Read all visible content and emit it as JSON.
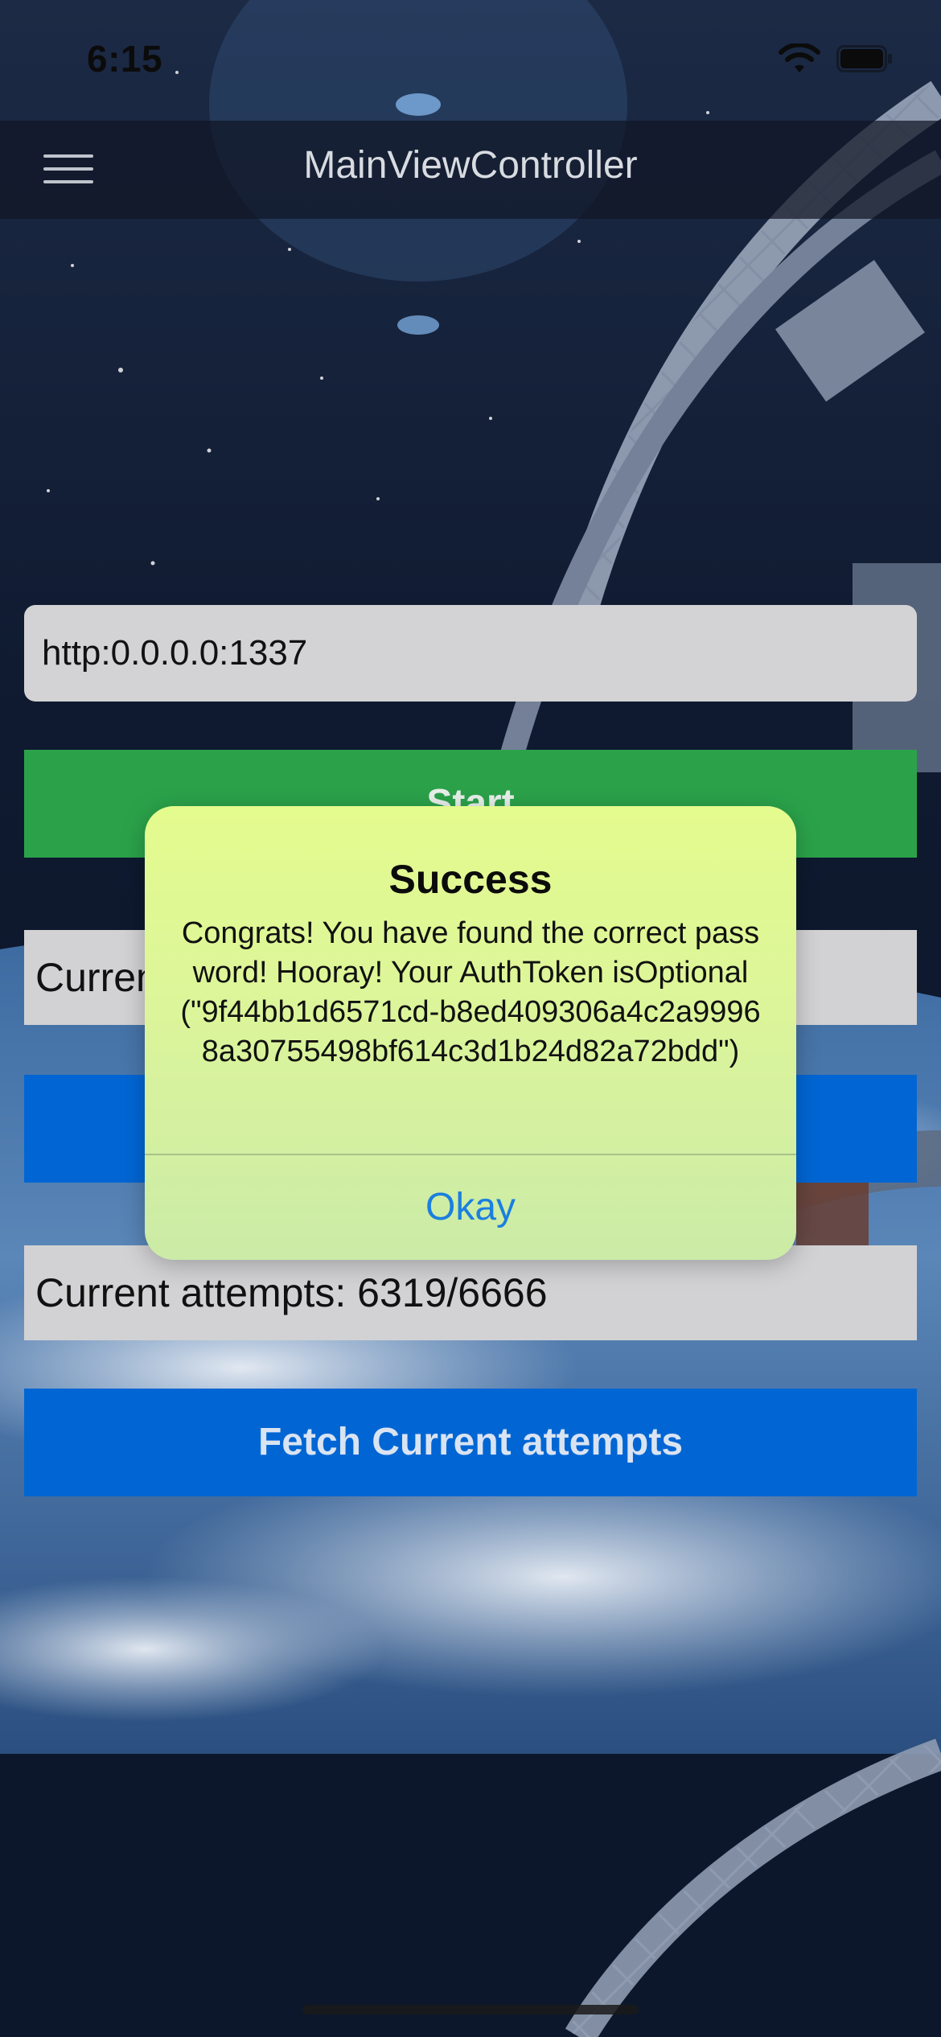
{
  "status_bar": {
    "time": "6:15",
    "icons": [
      "wifi-icon",
      "battery-icon"
    ]
  },
  "nav": {
    "title": "MainViewController",
    "menu_icon": "hamburger-menu-icon"
  },
  "form": {
    "url_value": "http:0.0.0.0:1337",
    "start_label": "Start",
    "current_partial_label": "Current",
    "current_attempts_label": "Current attempts: 6319/6666",
    "fetch_button_label": "Fetch Current attempts"
  },
  "alert": {
    "title": "Success",
    "message": "Congrats! You have found the correct password! Hooray! Your AuthToken isOptional(\"9f44bb1d6571cd-b8ed409306a4c2a99968a30755498bf614c3d1b24d82a72bdd\")",
    "okay_label": "Okay"
  },
  "colors": {
    "start_button": "#2ba24a",
    "blue_button": "#0166d4",
    "alert_accent": "#1b7fe0",
    "field_bg": "#d3d3d5"
  }
}
